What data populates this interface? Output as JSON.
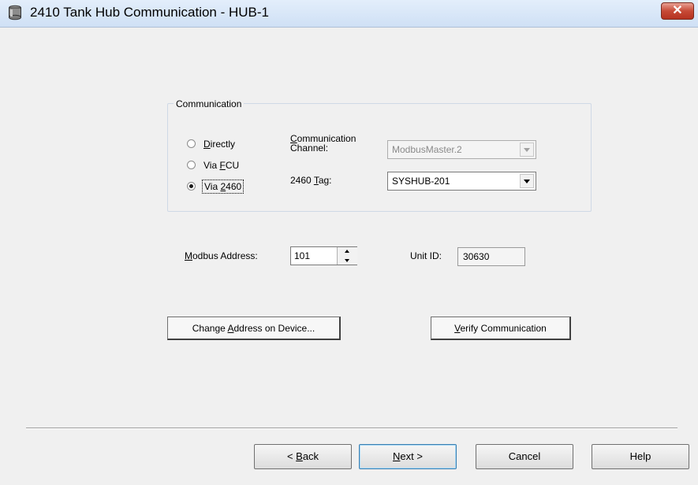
{
  "window": {
    "title": "2410 Tank Hub Communication - HUB-1",
    "close_label": "✕"
  },
  "communication": {
    "group_label": "Communication",
    "options": [
      {
        "pre": "",
        "accel": "D",
        "post": "irectly",
        "selected": false
      },
      {
        "pre": "Via ",
        "accel": "F",
        "post": "CU",
        "selected": false
      },
      {
        "pre": "Via ",
        "accel": "2",
        "post": "460",
        "selected": true
      }
    ],
    "channel_label_line1_accel": "C",
    "channel_label_line1_rest": "ommunication",
    "channel_label_line2": "Channel:",
    "channel_value": "ModbusMaster.2",
    "tag_label_pre": "2460 ",
    "tag_label_accel": "T",
    "tag_label_post": "ag:",
    "tag_value": "SYSHUB-201"
  },
  "modbus": {
    "label_accel": "M",
    "label_rest": "odbus Address:",
    "value": "101"
  },
  "unit": {
    "label": "Unit ID:",
    "value": "30630"
  },
  "actions": {
    "change_pre": "Change ",
    "change_accel": "A",
    "change_post": "ddress on Device...",
    "verify_accel": "V",
    "verify_post": "erify Communication"
  },
  "nav": {
    "back_pre": "< ",
    "back_accel": "B",
    "back_post": "ack",
    "next_accel": "N",
    "next_post": "ext >",
    "cancel": "Cancel",
    "help": "Help"
  }
}
